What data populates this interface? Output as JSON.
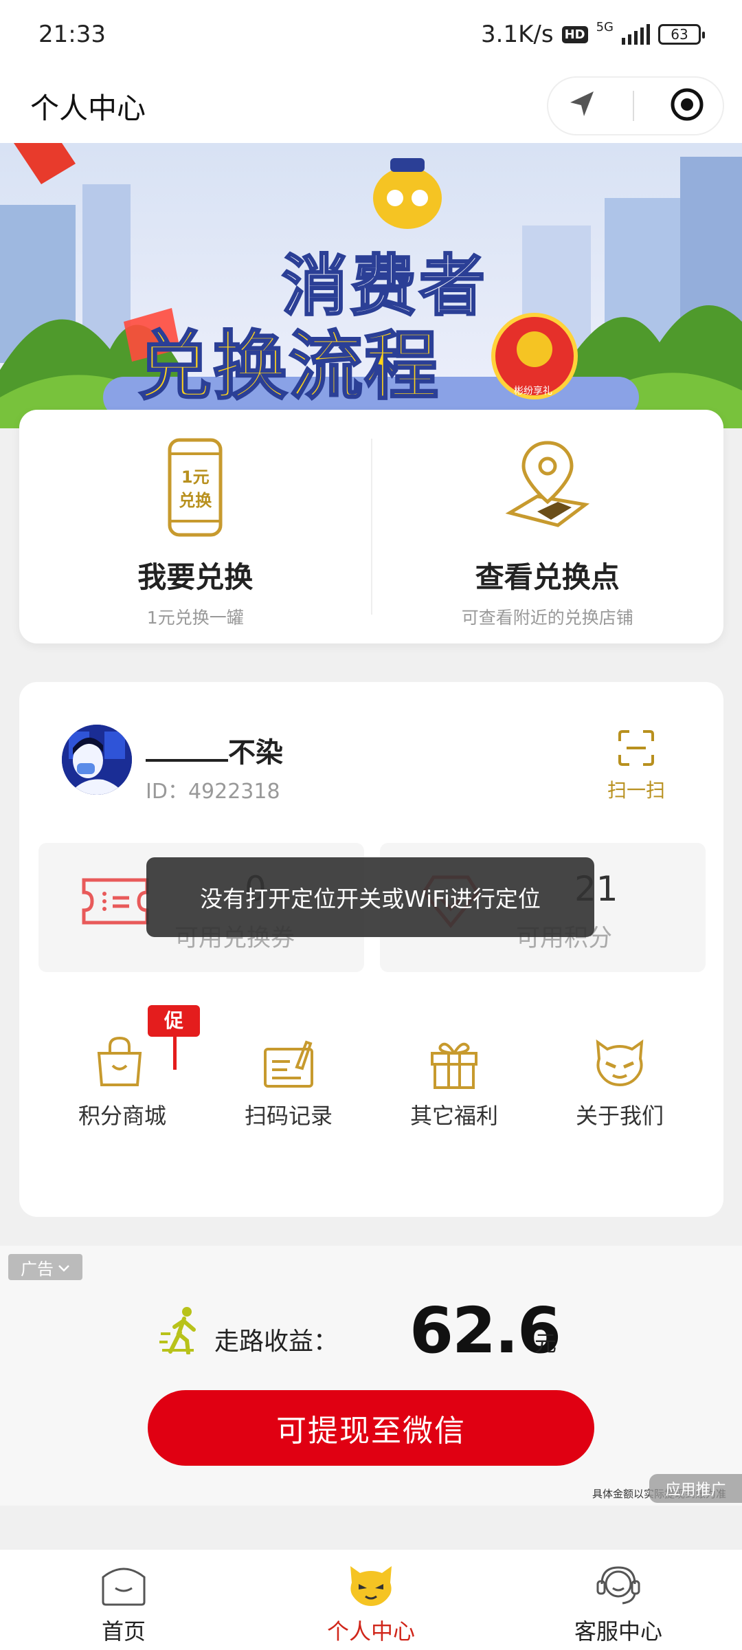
{
  "status_bar": {
    "time": "21:33",
    "speed": "3.1K/s",
    "hd": "HD",
    "network": "5G",
    "battery": "63"
  },
  "navbar": {
    "title": "个人中心"
  },
  "banner": {
    "line1": "消费者",
    "line2": "兑换流程",
    "badge": "彬纷享礼"
  },
  "exchange": {
    "items": [
      {
        "title": "我要兑换",
        "subtitle": "1元兑换一罐",
        "can_text": [
          "1元",
          "兑换"
        ]
      },
      {
        "title": "查看兑换点",
        "subtitle": "可查看附近的兑换店铺"
      }
    ]
  },
  "user": {
    "name": "不染",
    "id_label": "ID：4922318",
    "scan_label": "扫一扫"
  },
  "stats": [
    {
      "value": "0",
      "label": "可用兑换券"
    },
    {
      "value": "21",
      "label": "可用积分"
    }
  ],
  "menu": {
    "promo_badge": "促",
    "items": [
      {
        "label": "积分商城"
      },
      {
        "label": "扫码记录"
      },
      {
        "label": "其它福利"
      },
      {
        "label": "关于我们"
      }
    ]
  },
  "toast": "没有打开定位开关或WiFi进行定位",
  "ad": {
    "tag": "广告",
    "walk_label": "走路收益：",
    "amount": "62.6",
    "unit": "元",
    "button": "可提现至微信",
    "note": "具体金额以实际提现到账为准",
    "promo": "应用推广"
  },
  "tabbar": {
    "items": [
      {
        "label": "首页"
      },
      {
        "label": "个人中心"
      },
      {
        "label": "客服中心"
      }
    ]
  },
  "colors": {
    "gold": "#b8901e",
    "red": "#e00012",
    "active_tab": "#d0261a"
  }
}
